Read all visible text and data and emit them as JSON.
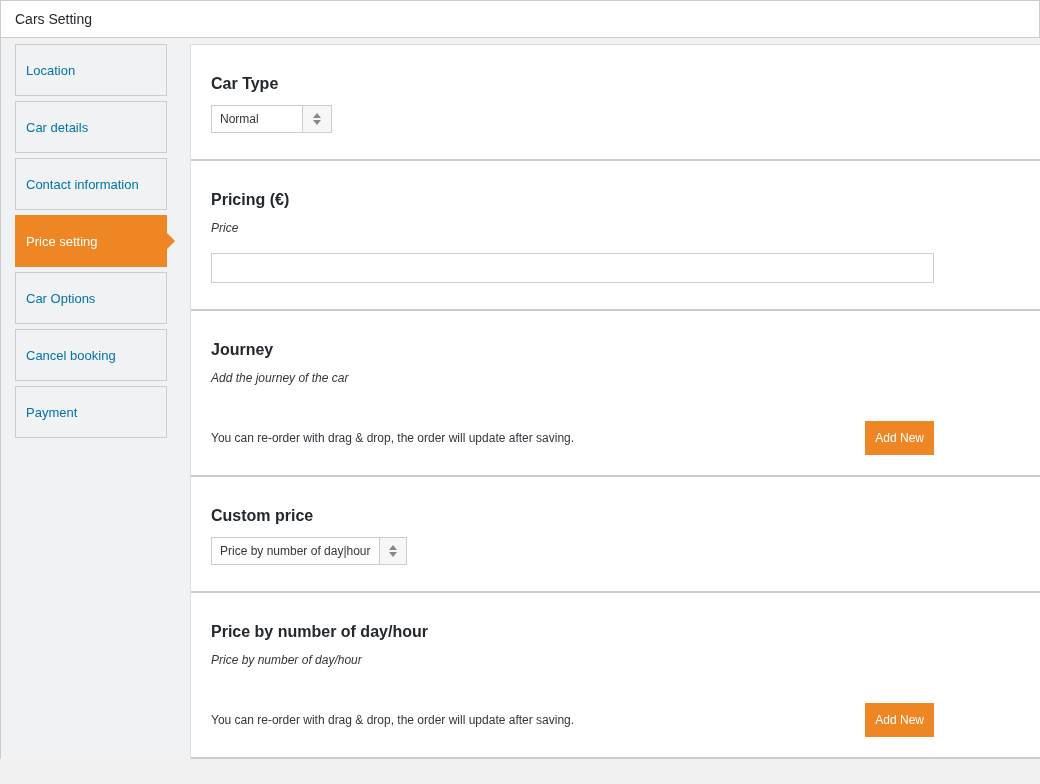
{
  "window": {
    "title": "Cars Setting"
  },
  "sidebar": {
    "items": [
      {
        "label": "Location",
        "selected": false
      },
      {
        "label": "Car details",
        "selected": false
      },
      {
        "label": "Contact information",
        "selected": false
      },
      {
        "label": "Price setting",
        "selected": true
      },
      {
        "label": "Car Options",
        "selected": false
      },
      {
        "label": "Cancel booking",
        "selected": false
      },
      {
        "label": "Payment",
        "selected": false
      }
    ]
  },
  "sections": [
    {
      "kind": "select",
      "title": "Car Type",
      "value": "Normal"
    },
    {
      "kind": "input",
      "title": "Pricing (€)",
      "label": "Price"
    },
    {
      "kind": "repeater",
      "title": "Journey",
      "description": "Add the journey of the car",
      "note": "You can re-order with drag & drop, the order will update after saving.",
      "button": "Add New"
    },
    {
      "kind": "select",
      "title": "Custom price",
      "value": "Price by number of day|hour"
    },
    {
      "kind": "repeater",
      "title": "Price by number of day/hour",
      "description": "Price by number of day/hour",
      "note": "You can re-order with drag & drop, the order will update after saving.",
      "button": "Add New"
    }
  ]
}
